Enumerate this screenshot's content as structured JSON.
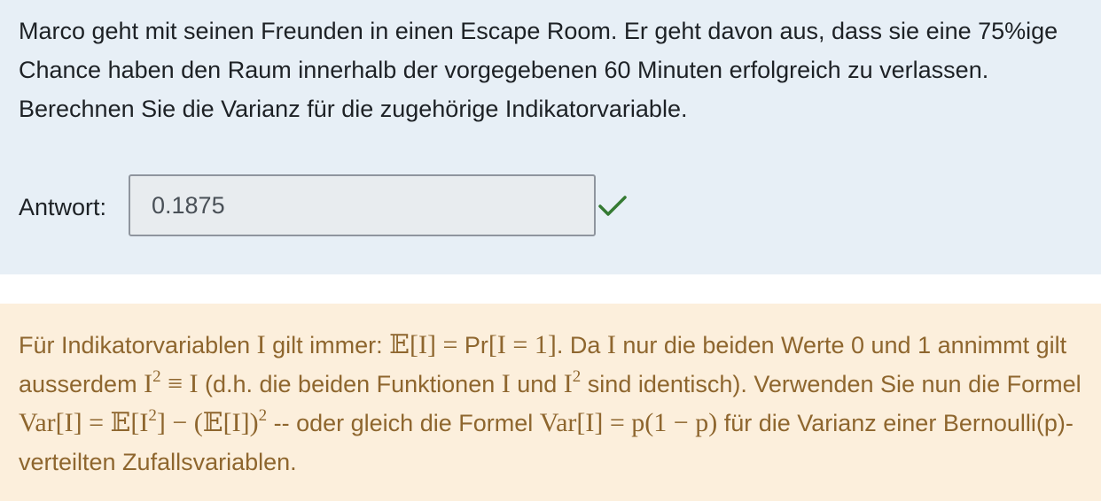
{
  "question": {
    "text": "Marco geht mit seinen Freunden in einen Escape Room. Er geht davon aus, dass sie eine 75%ige Chance haben den Raum innerhalb der vorgegebenen 60 Minuten erfolgreich zu verlassen. Berechnen Sie die Varianz für die zugehörige Indikatorvariable."
  },
  "answer": {
    "label": "Antwort:",
    "value": "0.1875",
    "status": "correct"
  },
  "feedback": {
    "t1": "Für Indikatorvariablen ",
    "m1": "I",
    "t2": " gilt immer: ",
    "m2": "𝔼[I] = ",
    "t3": "Pr",
    "m3": "[I = 1]",
    "t4": ". Da ",
    "m4": "I",
    "t5": " nur die beiden Werte 0 und 1 annimmt gilt ausserdem ",
    "m5_base": "I",
    "m5_exp": "2",
    "m5_rest": " ≡ I",
    "t6": " (d.h. die beiden Funktionen ",
    "m6": "I",
    "t7": " und ",
    "m7_base": "I",
    "m7_exp": "2",
    "t8": " sind identisch). Verwenden Sie nun die Formel ",
    "m8_a": "Var[I] = 𝔼[I",
    "m8_exp1": "2",
    "m8_b": "] − (𝔼[I])",
    "m8_exp2": "2",
    "t9": " -- oder gleich die Formel ",
    "m9": "Var[I] = p(1 − p)",
    "t10": " für die Varianz einer Bernoulli(p)-verteilten Zufallsvariablen."
  },
  "colors": {
    "question_bg": "#e7eff6",
    "feedback_bg": "#fcefdc",
    "feedback_text": "#8e662e",
    "check": "#357a32"
  },
  "icons": {
    "check": "check-icon"
  }
}
